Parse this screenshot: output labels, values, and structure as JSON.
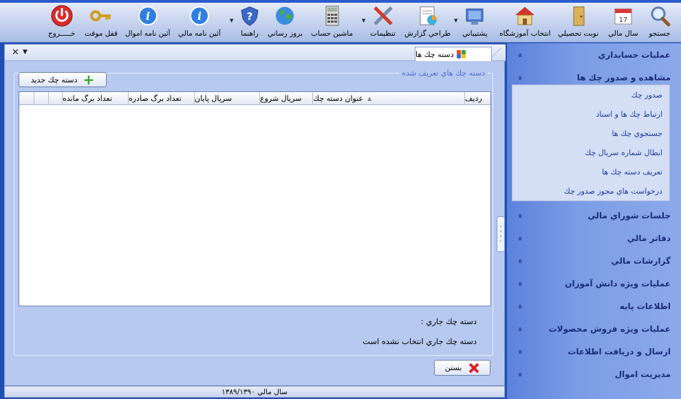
{
  "toolbar": {
    "buttons": [
      {
        "label": "جستجو",
        "icon": "search-icon"
      },
      {
        "label": "سال مالي",
        "icon": "calendar-icon"
      },
      {
        "label": "نوبت تحصيلي",
        "icon": "door-icon"
      },
      {
        "label": "انتخاب آموزشگاه",
        "icon": "school-house-icon"
      },
      {
        "label": "پشتيباني",
        "icon": "support-computer-icon"
      },
      {
        "label": "طراحي گزارش",
        "icon": "report-design-icon"
      },
      {
        "label": "تنظيمات",
        "icon": "tools-icon"
      },
      {
        "label": "ماشين حساب",
        "icon": "calculator-icon"
      },
      {
        "label": "بروز رساني",
        "icon": "globe-icon"
      },
      {
        "label": "راهنما",
        "icon": "help-shield-icon"
      },
      {
        "label": "آئين نامه مالي",
        "icon": "info-icon"
      },
      {
        "label": "آئين نامه اموال",
        "icon": "info-icon"
      },
      {
        "label": "قفل موقت",
        "icon": "key-icon"
      },
      {
        "label": "خـــــروج",
        "icon": "power-icon"
      }
    ]
  },
  "tabs": {
    "active_label": "دسته چك ها",
    "close_glyph": "✕",
    "menu_glyph": "▼"
  },
  "main": {
    "group_title": "دسته چك هاي تعريف شده",
    "new_button_label": "دسته چك جديد",
    "grid_columns": [
      "رديف",
      "عنوان دسته چك",
      "سريال شروع",
      "سريال پايان",
      "تعداد برگ صادره",
      "تعداد برگ مانده"
    ],
    "current_label": "دسته چك جاري :",
    "current_value": "دسته چك جاري انتخاب نشده است",
    "close_button_label": "بستن"
  },
  "statusbar": {
    "text": "سال مالي ۱۳۸۹/۱۳۹۰"
  },
  "nav": {
    "sections": [
      {
        "label": "عمليات حسابداري",
        "expanded": false
      },
      {
        "label": "مشاهده و صدور چك ها",
        "expanded": true
      },
      {
        "label": "جلسات شوراي مالي",
        "expanded": false
      },
      {
        "label": "دفاتر مالي",
        "expanded": false
      },
      {
        "label": "گزارشات مالي",
        "expanded": false
      },
      {
        "label": "عمليات ويژه دانش آموزان",
        "expanded": false
      },
      {
        "label": "اطلاعات پايه",
        "expanded": false
      },
      {
        "label": "عمليات ويژه فروش محصولات",
        "expanded": false
      },
      {
        "label": "ارسال و دريافت اطلاعات",
        "expanded": false
      },
      {
        "label": "مديريت اموال",
        "expanded": false
      }
    ],
    "sub_items": [
      "صدور چك",
      "ارتباط چك ها و اسناد",
      "جستجوي چك ها",
      "ابطال شماره سريال چك",
      "تعريف دسته چك ها",
      "درخواست هاي مجوز صدور چك"
    ],
    "collapsed_glyph": "»",
    "expanded_glyph": "«"
  }
}
